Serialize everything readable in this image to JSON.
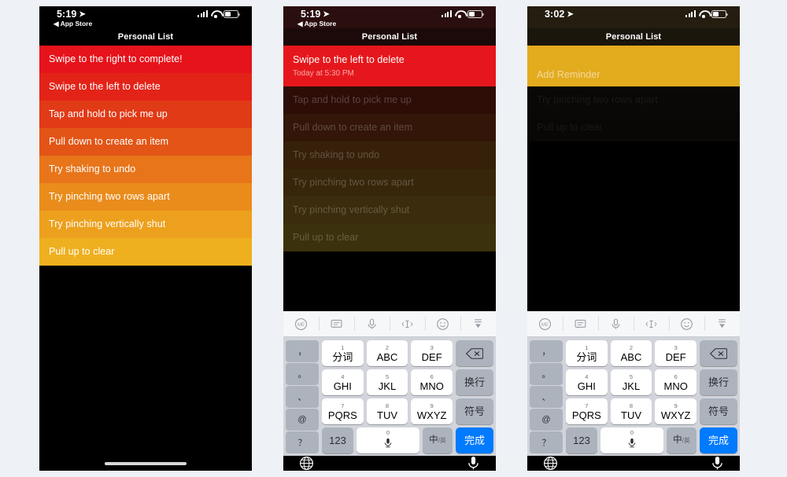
{
  "theme": {
    "bg": "#eef1f5",
    "accent_blue": "#007aff",
    "gradient_start": "#e30613",
    "gradient_end": "#eeb01f",
    "keyboard_bg": "#d1d4da",
    "key_white": "#ffffff",
    "key_grey": "#adb3bd"
  },
  "panels": [
    {
      "id": "panel-1",
      "status": {
        "time": "5:19",
        "location_icon": "location-arrow-icon",
        "back_label": "App Store",
        "has_back": true,
        "signal_icon": "cellular-signal-icon",
        "wifi_icon": "wifi-icon",
        "battery_icon": "battery-icon",
        "bar_tint": "#000000"
      },
      "nav": {
        "title": "Personal List"
      },
      "rows": [
        {
          "title": "Swipe to the right to complete!",
          "sub": "",
          "color": "#e6131b",
          "state": "normal"
        },
        {
          "title": "Swipe to the left to delete",
          "sub": "",
          "color": "#e42318",
          "state": "normal"
        },
        {
          "title": "Tap and hold to pick me up",
          "sub": "",
          "color": "#e13a17",
          "state": "normal"
        },
        {
          "title": "Pull down to create an item",
          "sub": "",
          "color": "#e25516",
          "state": "normal"
        },
        {
          "title": "Try shaking to undo",
          "sub": "",
          "color": "#e8751a",
          "state": "normal"
        },
        {
          "title": "Try pinching two rows apart",
          "sub": "",
          "color": "#ea8c1c",
          "state": "normal"
        },
        {
          "title": "Try pinching vertically shut",
          "sub": "",
          "color": "#eda01d",
          "state": "normal"
        },
        {
          "title": "Pull up to clear",
          "sub": "",
          "color": "#eeb01f",
          "state": "normal"
        }
      ],
      "has_keyboard": false,
      "has_home_indicator": true
    },
    {
      "id": "panel-2",
      "status": {
        "time": "5:19",
        "location_icon": "location-arrow-icon",
        "back_label": "App Store",
        "has_back": true,
        "signal_icon": "cellular-signal-icon",
        "wifi_icon": "wifi-icon",
        "battery_icon": "battery-icon",
        "bar_tint": "#2a0f0e"
      },
      "nav": {
        "title": "Personal List"
      },
      "rows": [
        {
          "title": "Swipe to the left to delete",
          "sub": "Today at 5:30 PM",
          "color": "#e6171c",
          "state": "editing"
        },
        {
          "title": "Tap and hold to pick me up",
          "sub": "",
          "color": "#2e0d07",
          "state": "dim"
        },
        {
          "title": "Pull down to create an item",
          "sub": "",
          "color": "#331608",
          "state": "dim"
        },
        {
          "title": "Try shaking to undo",
          "sub": "",
          "color": "#36200a",
          "state": "dim"
        },
        {
          "title": "Try pinching two rows apart",
          "sub": "",
          "color": "#38260b",
          "state": "dim"
        },
        {
          "title": "Try pinching vertically shut",
          "sub": "",
          "color": "#3a2c0c",
          "state": "dim"
        },
        {
          "title": "Pull up to clear",
          "sub": "",
          "color": "#3b310d",
          "state": "dim"
        }
      ],
      "has_keyboard": true,
      "has_home_indicator": false
    },
    {
      "id": "panel-3",
      "status": {
        "time": "3:02",
        "location_icon": "location-arrow-icon",
        "back_label": "",
        "has_back": false,
        "signal_icon": "cellular-signal-icon",
        "wifi_icon": "wifi-icon",
        "battery_icon": "battery-icon",
        "bar_tint": "#241d10"
      },
      "nav": {
        "title": "Personal List"
      },
      "rows": [
        {
          "title": "Add Reminder",
          "sub": "",
          "color": "#e3ab1e",
          "state": "placeholder"
        },
        {
          "title": "Try pinching two rows apart",
          "sub": "",
          "color": "#090806",
          "state": "ghost"
        },
        {
          "title": "Pull up to clear",
          "sub": "",
          "color": "#080705",
          "state": "ghost"
        }
      ],
      "has_keyboard": true,
      "has_home_indicator": false
    }
  ],
  "keyboard": {
    "toolbar": [
      {
        "icon": "memoji-circle-icon",
        "label": ""
      },
      {
        "icon": "message-bubble-icon",
        "label": ""
      },
      {
        "icon": "microphone-icon",
        "label": ""
      },
      {
        "icon": "text-cursor-icon",
        "label": ""
      },
      {
        "icon": "emoji-smiley-icon",
        "label": ""
      },
      {
        "icon": "dismiss-keyboard-icon",
        "label": ""
      }
    ],
    "punctuation_column": [
      {
        "label": "，"
      },
      {
        "label": "。"
      },
      {
        "label": "、"
      },
      {
        "label": "@"
      },
      {
        "label": "？"
      }
    ],
    "rows": [
      [
        {
          "num": "1",
          "label": "分词",
          "type": "cjk"
        },
        {
          "num": "2",
          "label": "ABC",
          "type": "latin"
        },
        {
          "num": "3",
          "label": "DEF",
          "type": "latin"
        },
        {
          "num": "",
          "label": "",
          "type": "backspace",
          "icon": "backspace-icon"
        }
      ],
      [
        {
          "num": "4",
          "label": "GHI",
          "type": "latin"
        },
        {
          "num": "5",
          "label": "JKL",
          "type": "latin"
        },
        {
          "num": "6",
          "label": "MNO",
          "type": "latin"
        },
        {
          "num": "",
          "label": "换行",
          "type": "fn"
        }
      ],
      [
        {
          "num": "7",
          "label": "PQRS",
          "type": "latin"
        },
        {
          "num": "8",
          "label": "TUV",
          "type": "latin"
        },
        {
          "num": "9",
          "label": "WXYZ",
          "type": "latin"
        },
        {
          "num": "",
          "label": "符号",
          "type": "fn"
        }
      ]
    ],
    "bottom_row": {
      "numeric_label": "123",
      "space_num": "0",
      "space_icon": "microphone-icon",
      "lang_label": "中",
      "lang_sub": "英",
      "done_label": "完成"
    },
    "system_bar": {
      "globe_icon": "globe-icon",
      "dictation_icon": "microphone-icon"
    }
  }
}
